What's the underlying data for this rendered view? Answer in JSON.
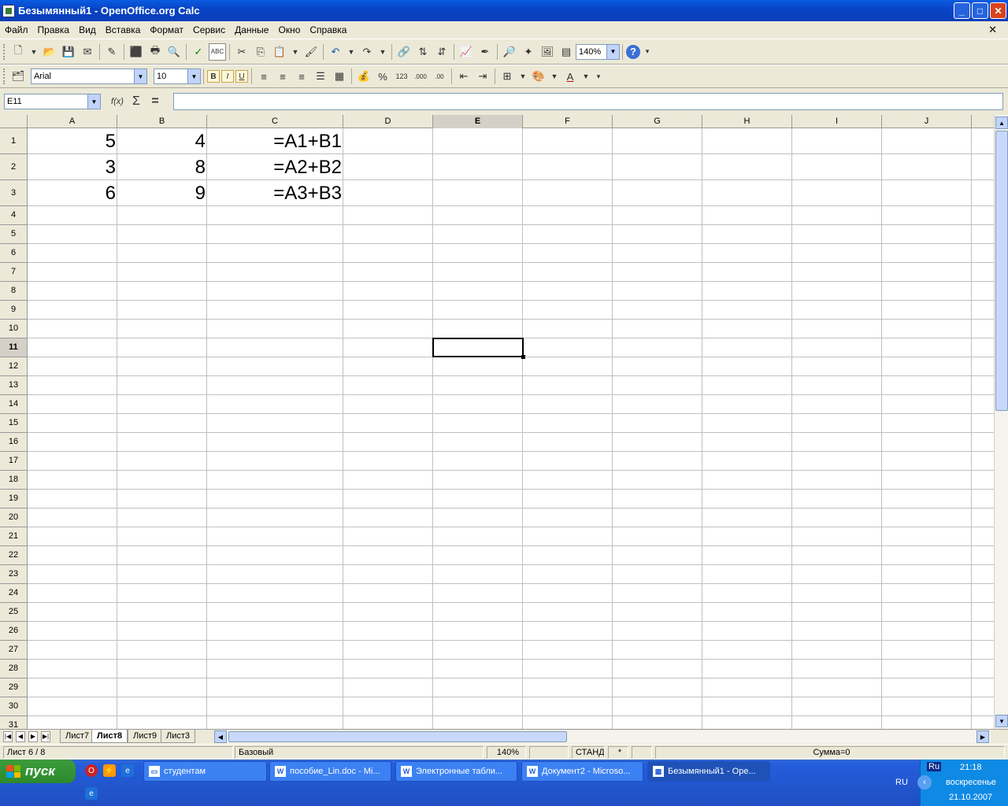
{
  "window": {
    "title": "Безымянный1 - OpenOffice.org Calc",
    "minimize": "_",
    "maximize": "□",
    "close": "✕"
  },
  "menu": {
    "items": [
      "Файл",
      "Правка",
      "Вид",
      "Вставка",
      "Формат",
      "Сервис",
      "Данные",
      "Окно",
      "Справка"
    ],
    "close_doc": "✕"
  },
  "toolbar": {
    "zoom": "140%"
  },
  "format_toolbar": {
    "font": "Arial",
    "size": "10",
    "bold": "B",
    "italic": "I",
    "underline": "U"
  },
  "formula_bar": {
    "name_box": "E11",
    "formula": ""
  },
  "sheet": {
    "columns": [
      "A",
      "B",
      "C",
      "D",
      "E",
      "F",
      "G",
      "H",
      "I",
      "J"
    ],
    "selected_column": "E",
    "rows": [
      "1",
      "2",
      "3",
      "4",
      "5",
      "6",
      "7",
      "8",
      "9",
      "10",
      "11",
      "12",
      "13",
      "14",
      "15",
      "16",
      "17",
      "18",
      "19",
      "20",
      "21",
      "22",
      "23",
      "24",
      "25",
      "26",
      "27",
      "28",
      "29",
      "30",
      "31"
    ],
    "selected_row": "11",
    "cells": {
      "A1": "5",
      "B1": "4",
      "C1": "=A1+B1",
      "A2": "3",
      "B2": "8",
      "C2": "=A2+B2",
      "A3": "6",
      "B3": "9",
      "C3": "=A3+B3"
    },
    "active_cell": "E11"
  },
  "tabs": {
    "items": [
      "Лист7",
      "Лист8",
      "Лист9",
      "Лист3"
    ],
    "active": "Лист8"
  },
  "status": {
    "sheet": "Лист 6 / 8",
    "style": "Базовый",
    "zoom": "140%",
    "mode": "СТАНД",
    "modified": "*",
    "sum": "Сумма=0"
  },
  "taskbar": {
    "start": "пуск",
    "tasks": [
      "студентам",
      "пособие_Lin.doc - Mi...",
      "Электронные табли...",
      "Документ2 - Microso...",
      "Безымянный1 - Ope..."
    ],
    "tray": {
      "lang": "Ru",
      "kbd": "RU",
      "time": "21:18",
      "day": "воскресенье",
      "date": "21.10.2007"
    }
  }
}
